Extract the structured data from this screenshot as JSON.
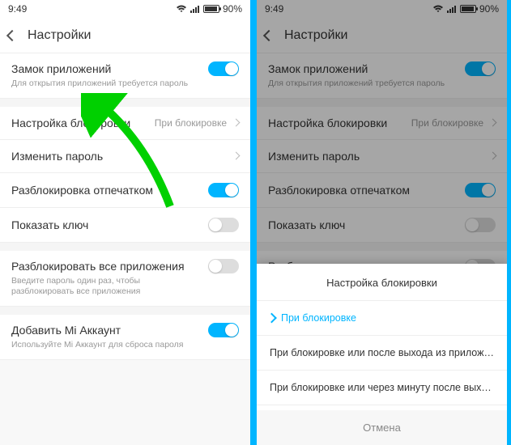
{
  "status": {
    "time": "9:49",
    "battery": "90%"
  },
  "header": {
    "title": "Настройки"
  },
  "items": {
    "app_lock": {
      "title": "Замок приложений",
      "sub": "Для открытия приложений требуется пароль"
    },
    "lock_mode": {
      "title": "Настройка блокировки",
      "value": "При блокировке"
    },
    "change_pw": {
      "title": "Изменить пароль"
    },
    "fingerprint": {
      "title": "Разблокировка отпечатком"
    },
    "show_key": {
      "title": "Показать ключ"
    },
    "unlock_all": {
      "title": "Разблокировать все приложения",
      "sub": "Введите пароль один раз, чтобы разблокировать все приложения"
    },
    "mi_account": {
      "title": "Добавить Mi Аккаунт",
      "sub": "Используйте Mi Аккаунт для сброса пароля"
    }
  },
  "sheet": {
    "title": "Настройка блокировки",
    "opt1": "При блокировке",
    "opt2": "При блокировке или после выхода из приложения",
    "opt3": "При блокировке или через минуту после выхода из прилож…",
    "cancel": "Отмена"
  }
}
